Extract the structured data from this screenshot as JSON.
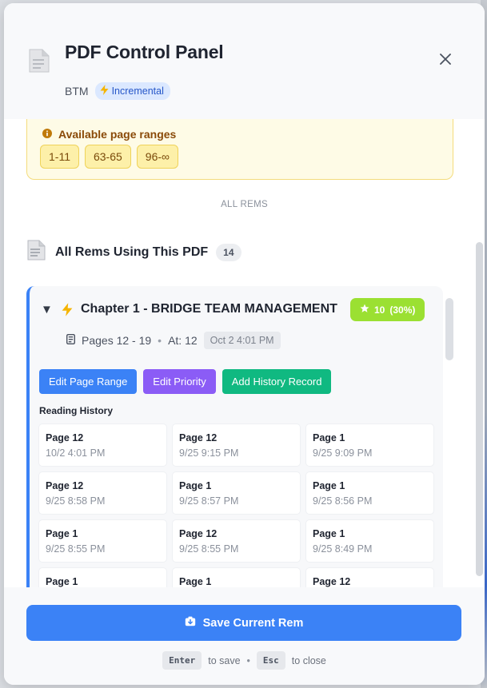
{
  "header": {
    "title": "PDF Control Panel",
    "source": "BTM",
    "mode_badge": "Incremental",
    "close_icon": "close-icon",
    "doc_icon": "pdf-document-icon"
  },
  "ranges": {
    "title": "Available page ranges",
    "items": [
      "1-11",
      "63-65",
      "96-∞"
    ]
  },
  "all_rems": {
    "section_label": "ALL REMS",
    "title": "All Rems Using This PDF",
    "count": "14"
  },
  "rem": {
    "title": "Chapter 1 - BRIDGE TEAM MANAGEMENT",
    "priority": "10",
    "priority_pct": "(30%)",
    "pages": "Pages 12 - 19",
    "at": "At: 12",
    "date": "Oct 2 4:01 PM",
    "actions": {
      "edit_range": "Edit Page Range",
      "edit_priority": "Edit Priority",
      "add_history": "Add History Record"
    },
    "history_title": "Reading History",
    "history": [
      {
        "page": "Page 12",
        "time": "10/2 4:01 PM"
      },
      {
        "page": "Page 12",
        "time": "9/25 9:15 PM"
      },
      {
        "page": "Page 1",
        "time": "9/25 9:09 PM"
      },
      {
        "page": "Page 12",
        "time": "9/25 8:58 PM"
      },
      {
        "page": "Page 1",
        "time": "9/25 8:57 PM"
      },
      {
        "page": "Page 1",
        "time": "9/25 8:56 PM"
      },
      {
        "page": "Page 1",
        "time": "9/25 8:55 PM"
      },
      {
        "page": "Page 12",
        "time": "9/25 8:55 PM"
      },
      {
        "page": "Page 1",
        "time": "9/25 8:49 PM"
      },
      {
        "page": "Page 1",
        "time": ""
      },
      {
        "page": "Page 1",
        "time": ""
      },
      {
        "page": "Page 12",
        "time": ""
      }
    ]
  },
  "footer": {
    "save_label": "Save Current Rem",
    "hint_save_key": "Enter",
    "hint_save": "to save",
    "hint_close_key": "Esc",
    "hint_close": "to close"
  },
  "colors": {
    "accent": "#3b82f6",
    "priority": "#9be032",
    "purple": "#8b5cf6",
    "green": "#10b981",
    "warning_bg": "#fefbe6"
  }
}
